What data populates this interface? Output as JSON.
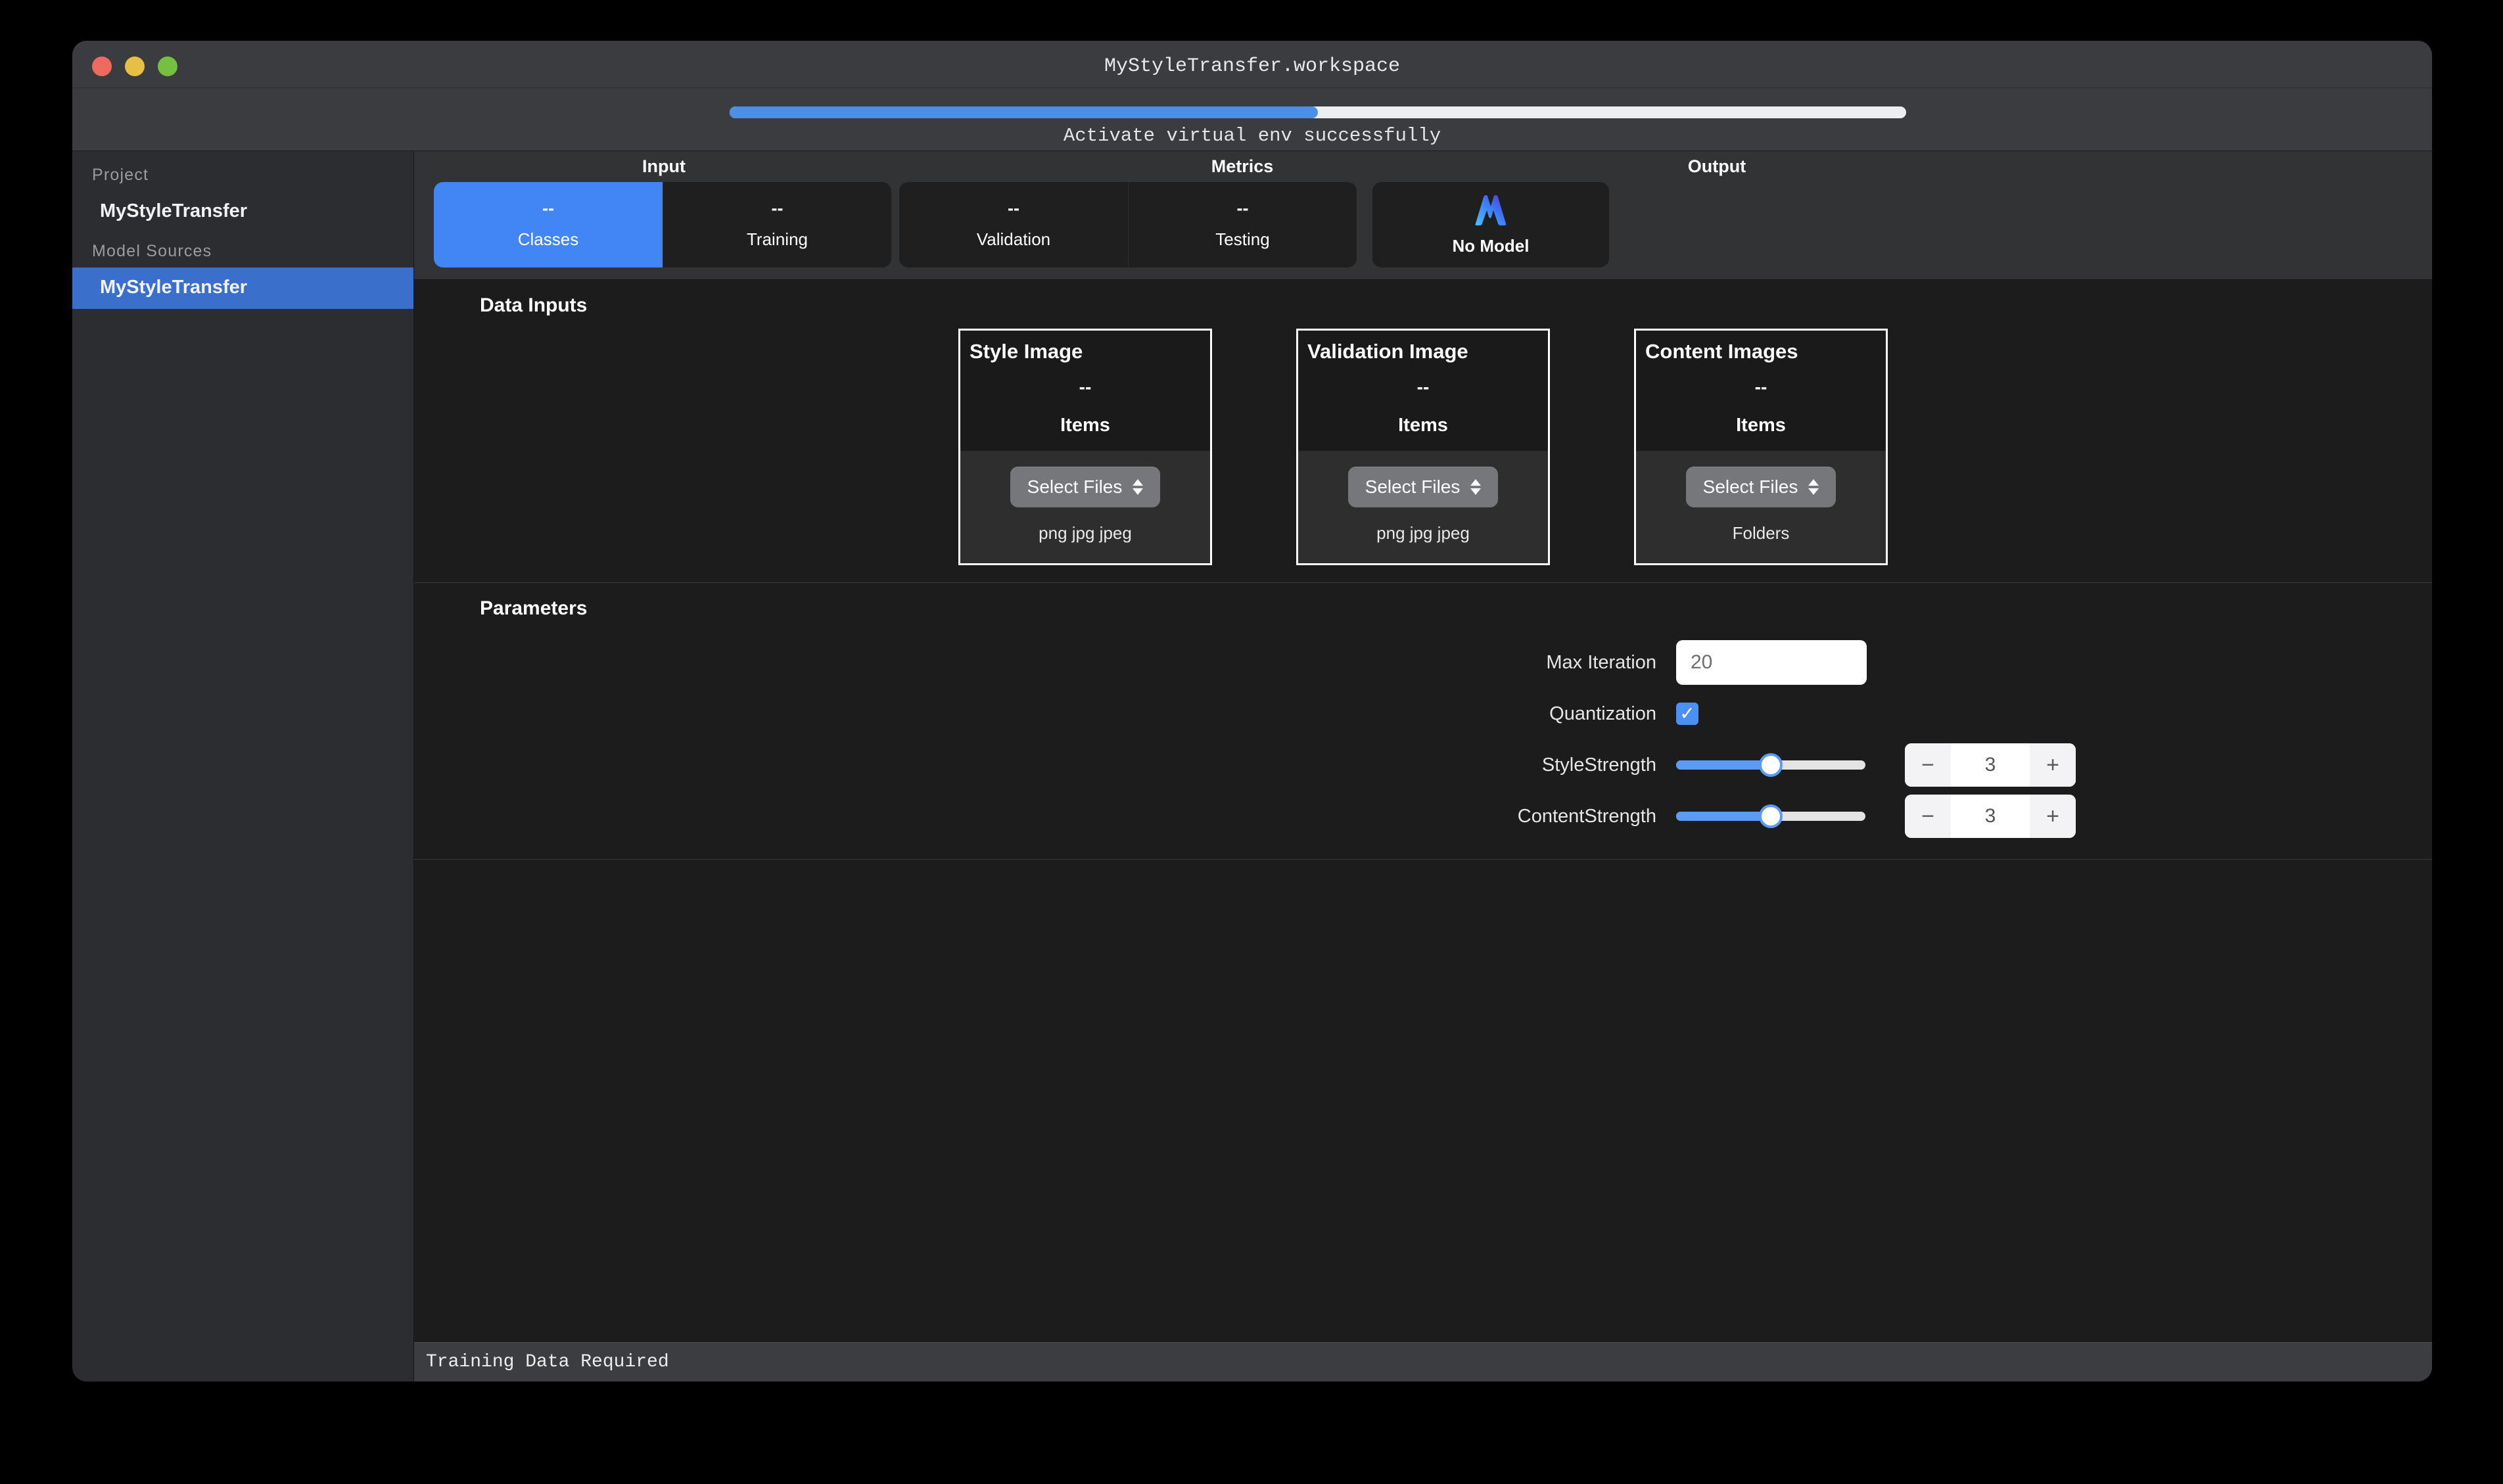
{
  "window": {
    "title": "MyStyleTransfer.workspace",
    "traffic_lights": [
      "close",
      "minimize",
      "zoom"
    ]
  },
  "progress": {
    "percent": 50,
    "status_text": "Activate virtual env successfully"
  },
  "sidebar": {
    "sections": [
      {
        "header": "Project",
        "items": [
          {
            "label": "MyStyleTransfer",
            "selected": false
          }
        ]
      },
      {
        "header": "Model Sources",
        "items": [
          {
            "label": "MyStyleTransfer",
            "selected": true
          }
        ]
      }
    ]
  },
  "tabstrip": {
    "groups": [
      {
        "title": "Input",
        "tabs": [
          {
            "value": "--",
            "name": "Classes",
            "active": true
          },
          {
            "value": "--",
            "name": "Training",
            "active": false
          }
        ]
      },
      {
        "title": "Metrics",
        "tabs": [
          {
            "value": "--",
            "name": "Validation",
            "active": false
          },
          {
            "value": "--",
            "name": "Testing",
            "active": false
          }
        ]
      }
    ],
    "output": {
      "title": "Output",
      "name": "No Model",
      "icon": "coreml-model-icon"
    }
  },
  "data_inputs": {
    "title": "Data Inputs",
    "cards": [
      {
        "title": "Style Image",
        "count": "--",
        "items_label": "Items",
        "button": "Select Files",
        "hint": "png jpg jpeg"
      },
      {
        "title": "Validation Image",
        "count": "--",
        "items_label": "Items",
        "button": "Select Files",
        "hint": "png jpg jpeg"
      },
      {
        "title": "Content Images",
        "count": "--",
        "items_label": "Items",
        "button": "Select Files",
        "hint": "Folders"
      }
    ]
  },
  "parameters": {
    "title": "Parameters",
    "max_iteration": {
      "label": "Max Iteration",
      "value": "20"
    },
    "quantization": {
      "label": "Quantization",
      "checked": true,
      "check_glyph": "✓"
    },
    "style_strength": {
      "label": "StyleStrength",
      "value": "3",
      "slider_percent": 50,
      "minus": "−",
      "plus": "+"
    },
    "content_strength": {
      "label": "ContentStrength",
      "value": "3",
      "slider_percent": 50,
      "minus": "−",
      "plus": "+"
    }
  },
  "statusbar": {
    "text": "Training Data Required"
  },
  "colors": {
    "accent_blue": "#4285f4",
    "selection_blue": "#3a6fcc",
    "slider_blue": "#5b9bf5",
    "window_chrome": "#3a3c3f",
    "panel_bg": "#1c1c1c",
    "sidebar_bg": "#2b2d31"
  }
}
